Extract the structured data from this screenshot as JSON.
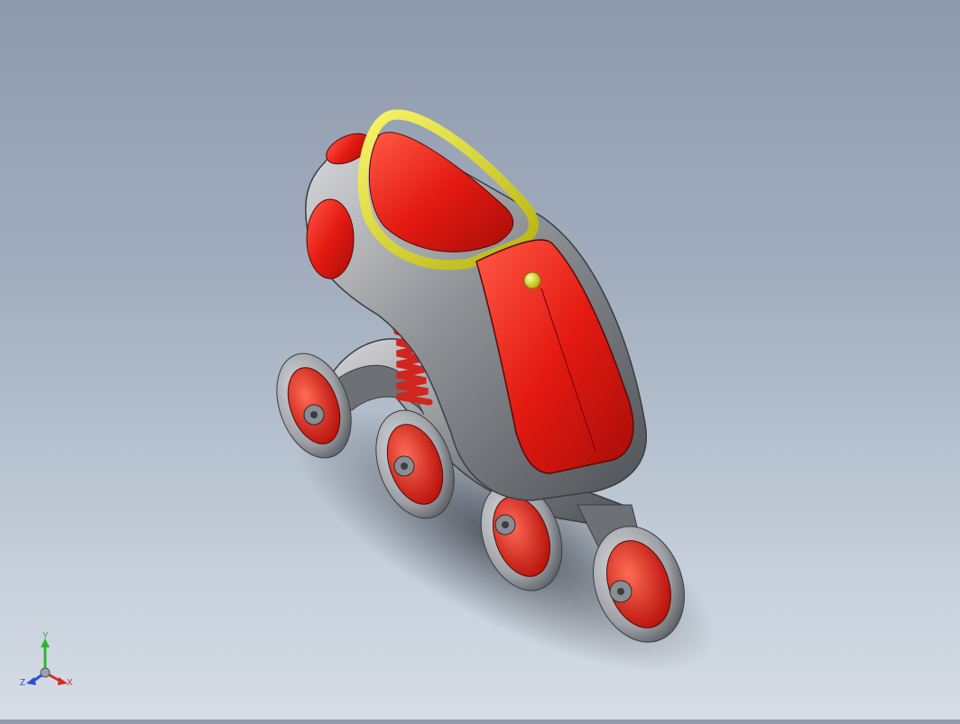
{
  "viewport": {
    "background_top": "#8e9aab",
    "background_bottom": "#d6dde6"
  },
  "model": {
    "colors": {
      "shell": "#e41a12",
      "body_gray": "#9a9ca0",
      "collar_yellow": "#e8e620",
      "wheel_tire": "#9da1a6",
      "spring": "#d0261f",
      "frame": "#6d7075"
    },
    "wheel_count": 4
  },
  "triad": {
    "y_label": "Y",
    "x_label": "X",
    "z_label": "Z",
    "y_color": "#2fb52f",
    "x_color": "#d42a2a",
    "z_color": "#2a4fd4"
  }
}
